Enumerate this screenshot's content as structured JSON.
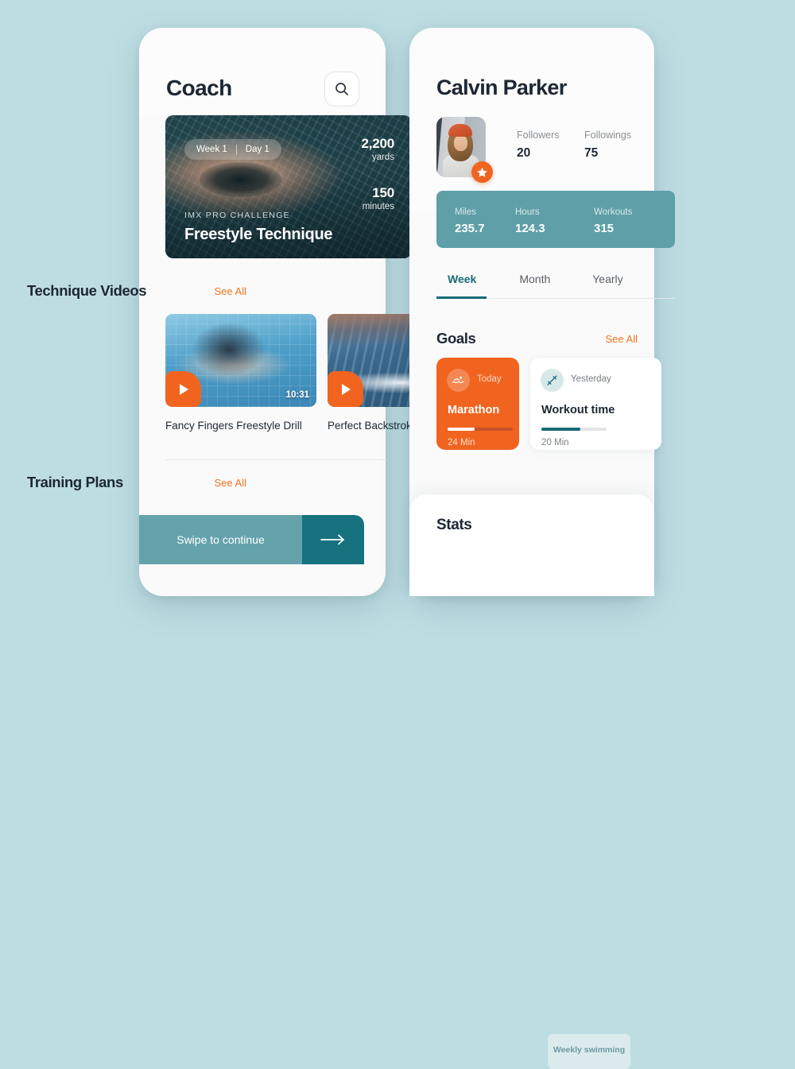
{
  "background_color": "#bedde3",
  "accent_orange": "#f1641f",
  "accent_teal": "#176b77",
  "teal_bar": "#5f9fa8",
  "left_screen": {
    "title": "Coach",
    "search_icon": "search-icon",
    "hero": {
      "pill_week": "Week 1",
      "pill_day": "Day 1",
      "stats": [
        {
          "value": "2,200",
          "unit": "yards"
        },
        {
          "value": "150",
          "unit": "minutes"
        }
      ],
      "kicker": "IMX PRO CHALLENGE",
      "name": "Freestyle Technique"
    },
    "videos_section": {
      "title": "Technique Videos",
      "see_all": "See All",
      "items": [
        {
          "caption": "Fancy Fingers Freestyle Drill",
          "duration": "10:31",
          "play_icon": "play-icon"
        },
        {
          "caption": "Perfect Backstroke Technique",
          "duration": "",
          "play_icon": "play-icon"
        }
      ]
    },
    "plans_section": {
      "title": "Training Plans",
      "see_all": "See All"
    },
    "swipe": {
      "label": "Swipe to continue",
      "arrow_icon": "arrow-right-icon"
    }
  },
  "right_screen": {
    "title": "Calvin Parker",
    "avatar": "avatar",
    "star_badge_icon": "star-icon",
    "follow_stats": [
      {
        "label": "Followers",
        "value": "20"
      },
      {
        "label": "Followings",
        "value": "75"
      }
    ],
    "summary_stats": [
      {
        "label": "Miles",
        "value": "235.7"
      },
      {
        "label": "Hours",
        "value": "124.3"
      },
      {
        "label": "Workouts",
        "value": "315"
      }
    ],
    "tabs": [
      {
        "label": "Week",
        "active": true
      },
      {
        "label": "Month",
        "active": false
      },
      {
        "label": "Yearly",
        "active": false
      }
    ],
    "goals_section": {
      "title": "Goals",
      "see_all": "See All",
      "items": [
        {
          "icon": "swimmer-icon",
          "when": "Today",
          "name": "Marathon",
          "value": "24 Min",
          "progress": 42
        },
        {
          "icon": "dumbbell-icon",
          "when": "Yesterday",
          "name": "Workout time",
          "value": "20 Min",
          "progress": 60
        }
      ]
    },
    "stats_section": {
      "title": "Stats",
      "chip_label": "Weekly swimming"
    }
  }
}
